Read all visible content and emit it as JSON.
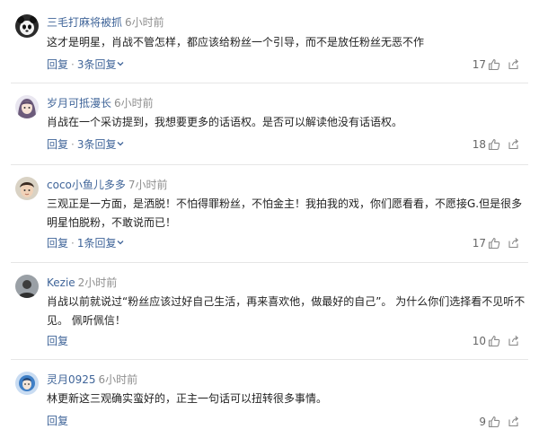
{
  "comments": [
    {
      "avatar_icon": "panda-avatar-icon",
      "author": "三毛打麻将被抓",
      "time": "6小时前",
      "text": "这才是明星，肖战不管怎样，都应该给粉丝一个引导，而不是放任粉丝无恶不作",
      "reply_label": "回复",
      "replies_label": "3条回复",
      "likes": "17"
    },
    {
      "avatar_icon": "anime-girl-avatar-icon",
      "author": "岁月可抵漫长",
      "time": "6小时前",
      "text": "肖战在一个采访提到，我想要更多的话语权。是否可以解读他没有话语权。",
      "reply_label": "回复",
      "replies_label": "3条回复",
      "likes": "18"
    },
    {
      "avatar_icon": "kid-avatar-icon",
      "author": "coco小鱼儿多多",
      "time": "7小时前",
      "text": "三观正是一方面，是洒脱！不怕得罪粉丝，不怕金主！我拍我的戏，你们愿看看，不愿接G.但是很多明星怕脱粉，不敢说而已！",
      "reply_label": "回复",
      "replies_label": "1条回复",
      "likes": "17"
    },
    {
      "avatar_icon": "person-avatar-icon",
      "author": "Kezie",
      "time": "2小时前",
      "text": "肖战以前就说过“粉丝应该过好自己生活，再来喜欢他，做最好的自己”。 为什么你们选择看不见听不见。 佩听佩信！",
      "reply_label": "回复",
      "replies_label": "",
      "likes": "10"
    },
    {
      "avatar_icon": "blue-avatar-icon",
      "author": "灵月0925",
      "time": "6小时前",
      "text": "林更新这三观确实蛮好的，正主一句话可以扭转很多事情。",
      "reply_label": "回复",
      "replies_label": "",
      "likes": "9"
    }
  ],
  "separator": "·"
}
